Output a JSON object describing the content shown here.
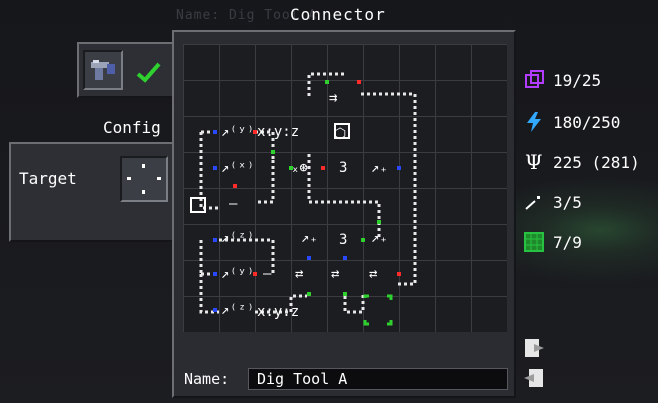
{
  "window": {
    "title": "Connector",
    "ghost_title": "Name:  Dig Tool A"
  },
  "left_panel": {
    "config_label": "Config",
    "target_label": "Target"
  },
  "stats": [
    {
      "icon": "cube-icon",
      "value": "19/25",
      "color": "#b23cff"
    },
    {
      "icon": "lightning-icon",
      "value": "180/250",
      "color": "#33a8ff"
    },
    {
      "icon": "psi-icon",
      "value": "225 (281)",
      "color": "#ffffff"
    },
    {
      "icon": "wand-icon",
      "value": "3/5",
      "color": "#ffffff"
    },
    {
      "icon": "grid-block-icon",
      "value": "7/9",
      "color": "#27c241"
    }
  ],
  "name_bar": {
    "label": "Name:",
    "value": "Dig Tool A"
  },
  "nodes": {
    "const_a": "3",
    "const_b": "3",
    "func_label": "x:y:z"
  },
  "colors": {
    "accent_green": "#2fd12f",
    "wire": "#e8e8e8",
    "port_red": "#ff2a2a",
    "port_blue": "#2a49ff",
    "port_green": "#1fd11f"
  }
}
